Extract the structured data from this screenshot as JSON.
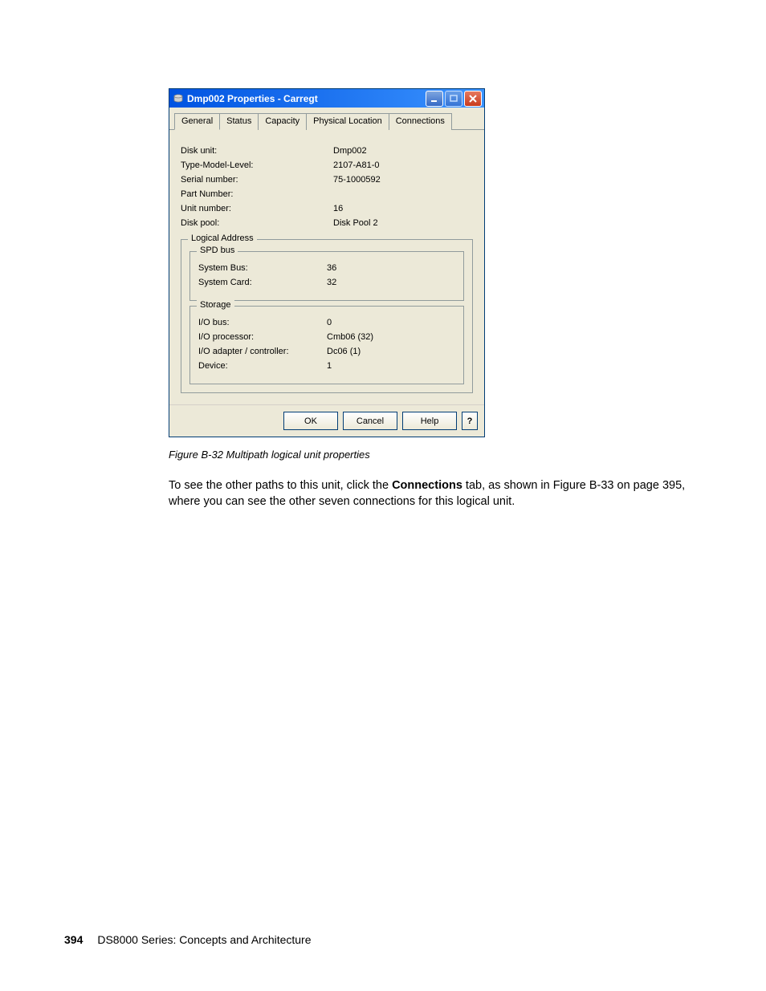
{
  "dialog": {
    "title": "Dmp002 Properties - Carregt",
    "tabs": [
      "General",
      "Status",
      "Capacity",
      "Physical Location",
      "Connections"
    ],
    "fields": {
      "disk_unit": {
        "label": "Disk unit:",
        "value": "Dmp002"
      },
      "type_model_level": {
        "label": "Type-Model-Level:",
        "value": "2107-A81-0"
      },
      "serial_number": {
        "label": "Serial number:",
        "value": "75-1000592"
      },
      "part_number": {
        "label": "Part Number:",
        "value": ""
      },
      "unit_number": {
        "label": "Unit number:",
        "value": "16"
      },
      "disk_pool": {
        "label": "Disk pool:",
        "value": "Disk Pool  2"
      }
    },
    "logical_address": {
      "legend": "Logical Address",
      "spd_bus": {
        "legend": "SPD bus",
        "system_bus": {
          "label": "System Bus:",
          "value": "36"
        },
        "system_card": {
          "label": "System Card:",
          "value": "32"
        }
      },
      "storage": {
        "legend": "Storage",
        "io_bus": {
          "label": "I/O bus:",
          "value": "0"
        },
        "io_processor": {
          "label": "I/O processor:",
          "value": "Cmb06 (32)"
        },
        "io_adapter": {
          "label": "I/O adapter / controller:",
          "value": "Dc06 (1)"
        },
        "device": {
          "label": "Device:",
          "value": "1"
        }
      }
    },
    "buttons": {
      "ok": "OK",
      "cancel": "Cancel",
      "help": "Help",
      "question": "?"
    }
  },
  "caption": "Figure B-32   Multipath logical unit properties",
  "paragraph": {
    "pre": "To see the other paths to this unit, click the ",
    "bold": "Connections",
    "post": " tab, as shown in Figure B-33 on page 395, where you can see the other seven connections for this logical unit."
  },
  "footer": {
    "page": "394",
    "title": "DS8000 Series: Concepts and Architecture"
  }
}
